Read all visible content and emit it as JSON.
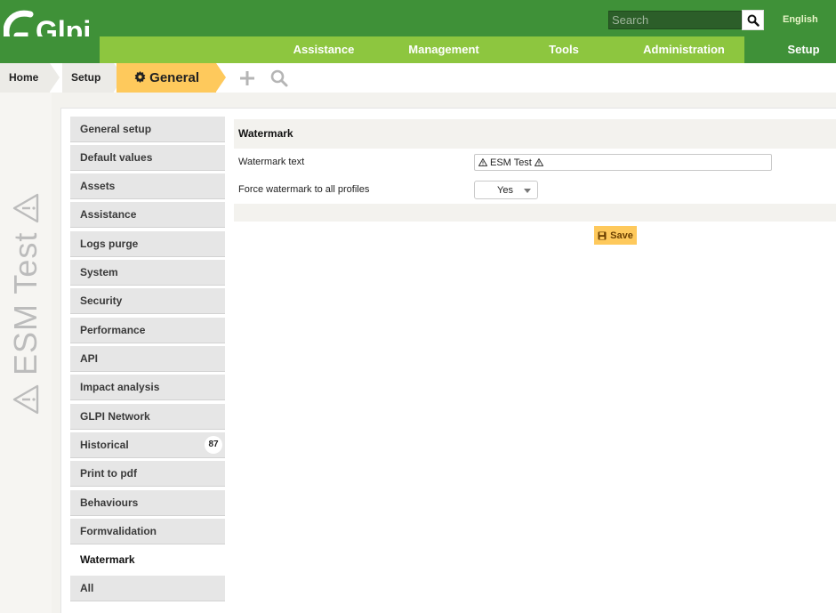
{
  "header": {
    "logo_text": "Glpi",
    "search": {
      "placeholder": "Search",
      "value": ""
    },
    "language": "English",
    "menu": [
      {
        "label": "Assistance"
      },
      {
        "label": "Management"
      },
      {
        "label": "Tools"
      },
      {
        "label": "Administration"
      },
      {
        "label": "Setup",
        "active": true
      }
    ]
  },
  "breadcrumb": {
    "items": [
      {
        "label": "Home"
      },
      {
        "label": "Setup"
      },
      {
        "label": "General",
        "active": true
      }
    ],
    "tools": [
      "plus-icon",
      "search-icon"
    ]
  },
  "watermark": {
    "text": "ESM Test",
    "icon": "warning-icon"
  },
  "tabs": [
    {
      "label": "General setup"
    },
    {
      "label": "Default values"
    },
    {
      "label": "Assets"
    },
    {
      "label": "Assistance"
    },
    {
      "label": "Logs purge"
    },
    {
      "label": "System"
    },
    {
      "label": "Security"
    },
    {
      "label": "Performance"
    },
    {
      "label": "API"
    },
    {
      "label": "Impact analysis"
    },
    {
      "label": "GLPI Network"
    },
    {
      "label": "Historical",
      "badge": "87"
    },
    {
      "label": "Print to pdf"
    },
    {
      "label": "Behaviours"
    },
    {
      "label": "Formvalidation"
    },
    {
      "label": "Watermark",
      "active": true
    },
    {
      "label": "All"
    }
  ],
  "form": {
    "title": "Watermark",
    "fields": [
      {
        "label": "Watermark text",
        "value": "ESM Test"
      },
      {
        "label": "Force watermark to all profiles",
        "value": "Yes"
      }
    ],
    "save_label": "Save"
  },
  "colors": {
    "header_dark": "#3f9138",
    "header_light": "#8dc63f",
    "accent": "#fec95c"
  }
}
